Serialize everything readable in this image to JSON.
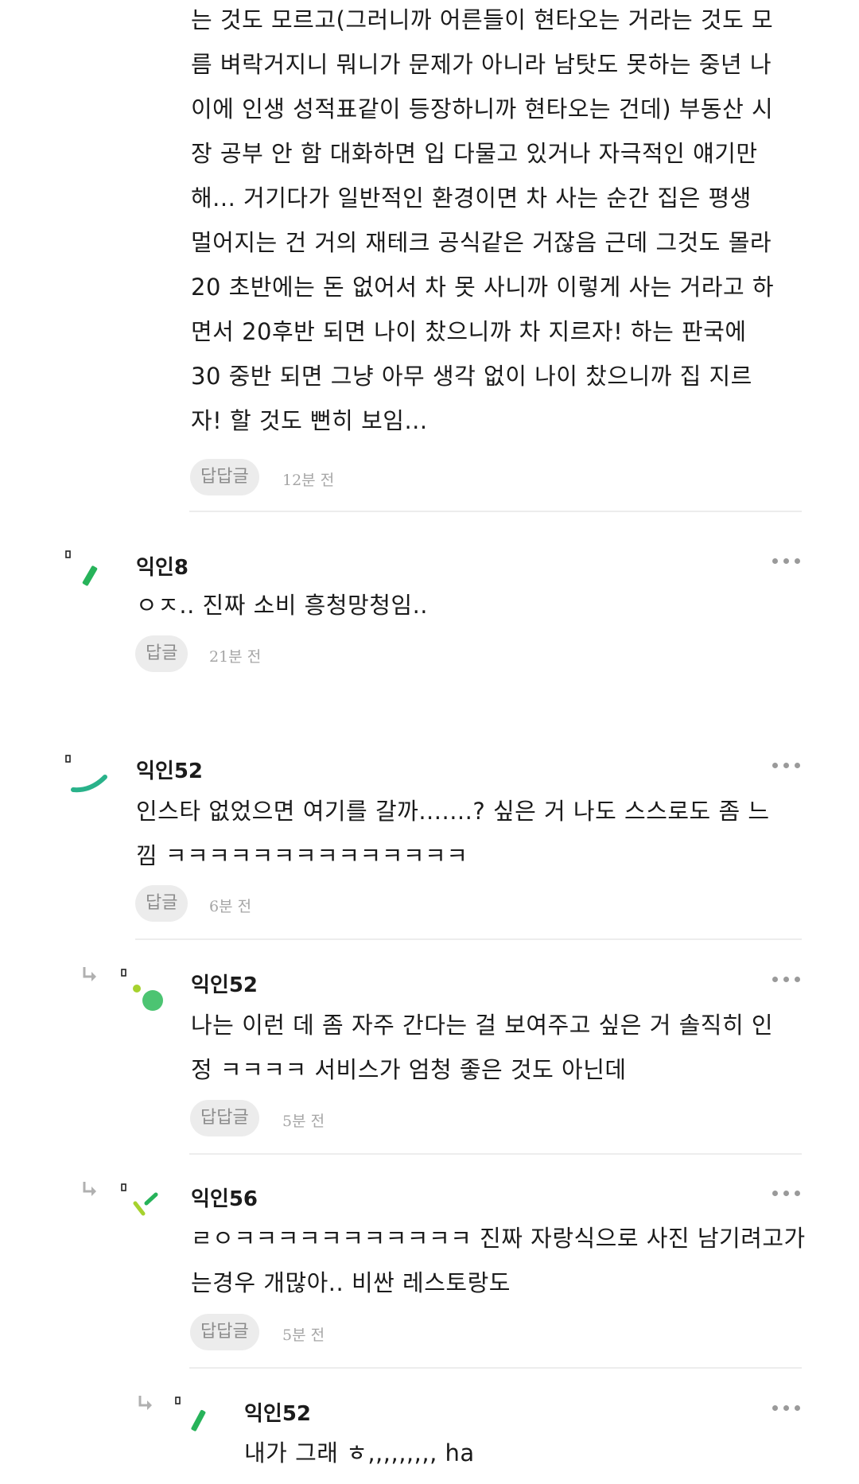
{
  "comments": [
    {
      "text": "는 것도 모르고(그러니까 어른들이 현타오는 거라는 것도 모\n름 벼락거지니 뭐니가 문제가 아니라 남탓도 못하는 중년 나\n이에 인생 성적표같이 등장하니까 현타오는 건데) 부동산 시\n장 공부 안 함 대화하면 입 다물고 있거나 자극적인 얘기만\n해... 거기다가 일반적인 환경이면 차 사는 순간 집은 평생\n멀어지는 건 거의 재테크 공식같은 거잖음 근데 그것도 몰라\n20 초반에는 돈 없어서 차 못 사니까 이렇게 사는 거라고 하\n면서 20후반 되면 나이 찼으니까 차 지르자! 하는 판국에\n30 중반 되면 그냥 아무 생각 없이 나이 찼으니까 집 지르\n자! 할 것도 뻔히 보임...",
      "reply_label": "답답글",
      "time": "12분 전"
    },
    {
      "author": "익인8",
      "text": "ㅇㅈ.. 진짜 소비 흥청망청임..",
      "reply_label": "답글",
      "time": "21분 전",
      "avatar_color": "#27b35a"
    },
    {
      "author": "익인52",
      "text": "인스타 없었으면 여기를 갈까.......? 싶은 거 나도 스스로도 좀 느\n낌 ㅋㅋㅋㅋㅋㅋㅋㅋㅋㅋㅋㅋㅋㅋ",
      "reply_label": "답글",
      "time": "6분 전",
      "avatar_color": "#29b28a"
    },
    {
      "author": "익인52",
      "text": "나는 이런 데 좀 자주 간다는 걸 보여주고 싶은 거 솔직히 인\n정 ㅋㅋㅋㅋ 서비스가 엄청 좋은 것도 아닌데",
      "reply_label": "답답글",
      "time": "5분 전",
      "avatar_color": "#4cc472"
    },
    {
      "author": "익인56",
      "text": "ㄹㅇㅋㅋㅋㅋㅋㅋㅋㅋㅋㅋㅋ 진짜 자랑식으로 사진 남기려고가\n는경우 개많아.. 비싼 레스토랑도",
      "reply_label": "답답글",
      "time": "5분 전",
      "avatar_color": "#a6d22e"
    },
    {
      "author": "익인52",
      "text": "내가 그래 ㅎ,,,,,,,,, ha",
      "avatar_color": "#27b35a"
    }
  ],
  "icons": {
    "more": "more-dots-icon",
    "reply_arrow": "reply-arrow-icon"
  },
  "colors": {
    "accent_green": "#27b35a",
    "muted": "#a6a6a6"
  }
}
